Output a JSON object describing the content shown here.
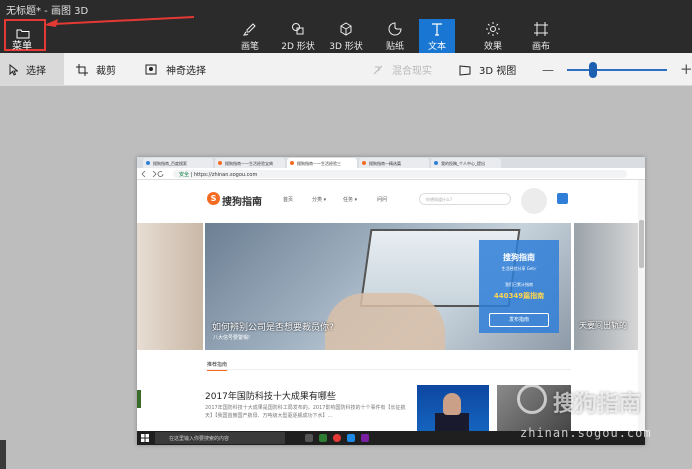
{
  "window": {
    "title": "无标题* - 画图 3D"
  },
  "menu": {
    "label": "菜单"
  },
  "toolbar": {
    "tools": [
      {
        "id": "brushes",
        "label": "画笔"
      },
      {
        "id": "2d-shapes",
        "label": "2D 形状"
      },
      {
        "id": "3d-shapes",
        "label": "3D 形状"
      },
      {
        "id": "stickers",
        "label": "贴纸"
      },
      {
        "id": "text",
        "label": "文本",
        "active": true
      },
      {
        "id": "effects",
        "label": "效果"
      },
      {
        "id": "canvas",
        "label": "画布"
      }
    ]
  },
  "subtoolbar": {
    "select": "选择",
    "crop": "裁剪",
    "magic_select": "神奇选择",
    "mixed_reality": "混合现实",
    "view_3d": "3D 视图",
    "zoom_minus": "—",
    "zoom_plus": "+",
    "zoom_level": 0.22
  },
  "canvas_image": {
    "tabs": [
      "搜狗指南_百度搜索",
      "搜狗指南——生活经验宝典",
      "搜狗指南——生活经验三",
      "搜狗指南—精选篇",
      "我的投稿_个人中心_提出"
    ],
    "address": {
      "secure": "安全",
      "url": "https://zhinan.sogou.com"
    },
    "site": {
      "logo_letter": "S",
      "logo_text": "搜狗指南",
      "nav": [
        "首页",
        "分类 ▾",
        "任务 ▾",
        "问问"
      ],
      "search_placeholder": "你想知道什么?"
    },
    "banner": {
      "caption": "如何辨别公司是否想要裁员你?",
      "subcaption": "八大信号要警惕!",
      "right_caption": "天要间出轨的"
    },
    "card": {
      "title": "搜狗指南",
      "subtitle": "生活经验分享 Get√",
      "cumulative_label": "我们已累计指南",
      "count": "440349篇指南",
      "button": "发布指南"
    },
    "section_tab": "推荐指南",
    "article": {
      "title": "2017年国防科技十大成果有哪些",
      "text": "2017年国防科技十大成果是国防科工局发布的。2017影响国防科技的十个事件有【长征航天】【我国首艘国产航母、万吨级大型驱逐舰成功下水】…"
    },
    "taskbar": {
      "search_text": "在这里输入你要搜索的内容"
    }
  },
  "watermark": {
    "main": "搜狗指南",
    "url": "zhinan.sogou.com"
  },
  "colors": {
    "accent": "#1976d2",
    "highlight_box": "#e53935",
    "brand_orange": "#f36c21"
  }
}
